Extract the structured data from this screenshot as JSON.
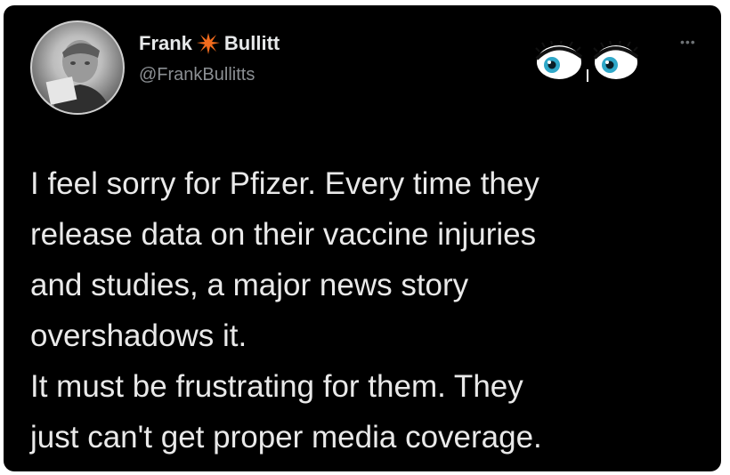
{
  "author": {
    "name_first": "Frank",
    "name_last": "Bullitt",
    "handle": "@FrankBullitts"
  },
  "icons": {
    "star": "orange-starburst-icon",
    "eyes": "cartoon-eyes-icon",
    "more": "more-options-icon",
    "avatar": "profile-photo"
  },
  "more_label": "•••",
  "tweet": {
    "lines": [
      "I feel sorry for Pfizer. Every time they",
      "release data on their vaccine injuries",
      "and studies, a major news story",
      "overshadows it.",
      "It must be frustrating for them.  They",
      "just can't get proper media coverage."
    ]
  },
  "colors": {
    "background": "#000000",
    "text": "#e9e9e9",
    "handle": "#8b8f93",
    "star": "#f26b1d",
    "eye_iris": "#2fa8c9"
  }
}
